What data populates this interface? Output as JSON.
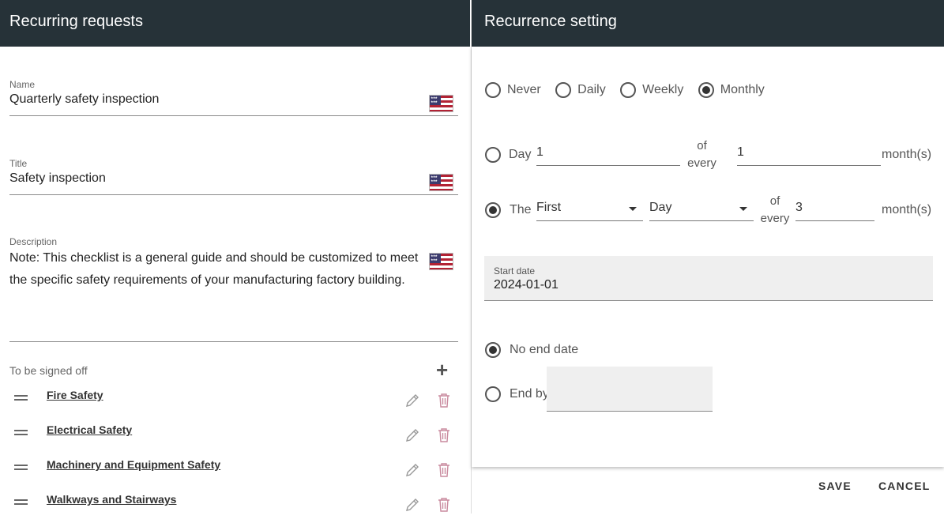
{
  "left": {
    "title": "Recurring requests",
    "name": {
      "label": "Name",
      "value": "Quarterly safety inspection",
      "flag": "us-flag-icon"
    },
    "title_field": {
      "label": "Title",
      "value": "Safety inspection",
      "flag": "us-flag-icon"
    },
    "description": {
      "label": "Description",
      "value": "Note: This checklist is a general guide and should be customized to meet the specific safety requirements of your manufacturing factory building.",
      "flag": "us-flag-icon"
    },
    "signoff": {
      "label": "To be signed off",
      "add_icon": "plus-icon",
      "items": [
        {
          "label": "Fire Safety"
        },
        {
          "label": "Electrical Safety"
        },
        {
          "label": "Machinery and Equipment Safety"
        },
        {
          "label": "Walkways and Stairways"
        }
      ]
    }
  },
  "right": {
    "title": "Recurrence setting",
    "frequency": {
      "options": [
        "Never",
        "Daily",
        "Weekly",
        "Monthly"
      ],
      "selected": "Monthly"
    },
    "day_option": {
      "label": "Day",
      "day_value": "1",
      "of_every": "of\nevery",
      "months_value": "1",
      "unit": "month(s)",
      "selected": false
    },
    "the_option": {
      "label": "The",
      "ordinal": "First",
      "day_type": "Day",
      "of_every": "of\nevery",
      "months_value": "3",
      "unit": "month(s)",
      "selected": true
    },
    "start_date": {
      "label": "Start date",
      "value": "2024-01-01"
    },
    "end": {
      "no_end_label": "No end date",
      "end_by_label": "End by",
      "selected": "No end date"
    },
    "actions": {
      "save": "SAVE",
      "cancel": "CANCEL"
    }
  },
  "colors": {
    "header_bg": "#263238",
    "header_text": "#ffffff",
    "delete_icon": "#c98a9e"
  }
}
